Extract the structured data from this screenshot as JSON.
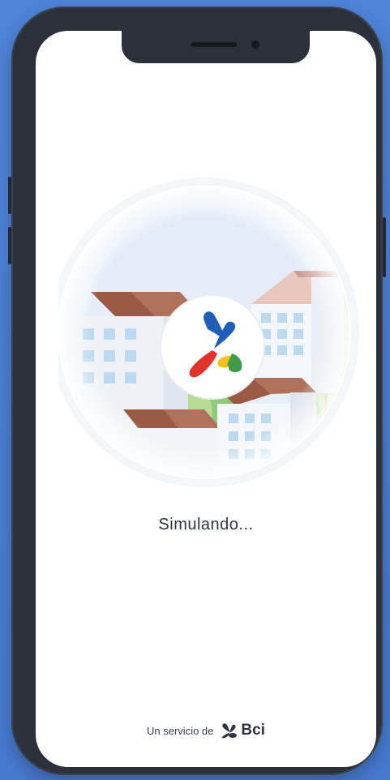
{
  "app": {
    "status_text": "Simulando...",
    "footer": {
      "prefix": "Un servicio de",
      "brand": "Bci"
    }
  },
  "colors": {
    "background": "#4a7fd4",
    "phone_frame": "#2b303a",
    "logo_blue": "#1f5fb8",
    "logo_red": "#e2332b",
    "logo_yellow": "#f4c21b",
    "logo_green": "#3f9b4a"
  },
  "icons": [
    "app-logo-icon",
    "bci-logo-icon",
    "camera-icon",
    "speaker-icon"
  ]
}
